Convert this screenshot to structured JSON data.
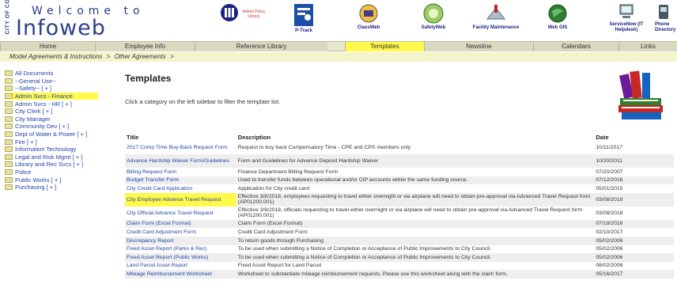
{
  "header": {
    "city_logo": "CITY OF CORONA",
    "welcome": "Welcome to",
    "brand": "Infoweb",
    "apps": [
      {
        "label": "Admin Policy Library",
        "icon": "library-icon"
      },
      {
        "label": "P-Track",
        "icon": "ptrack-icon"
      },
      {
        "label": "ClassWeb",
        "icon": "classweb-icon"
      },
      {
        "label": "SafetyWeb",
        "icon": "safetyweb-icon"
      },
      {
        "label": "Facility Maintenance",
        "icon": "facility-icon"
      },
      {
        "label": "Web GIS",
        "icon": "globe-icon"
      },
      {
        "label": "ServiceNow (IT Helpdesk)",
        "icon": "computer-icon"
      },
      {
        "label": "Phone Directory",
        "icon": "phone-icon"
      }
    ]
  },
  "nav": {
    "tabs": [
      "Home",
      "Employee Info",
      "Reference Library",
      "Templates",
      "Newsline",
      "Calendars",
      "Links"
    ],
    "active": "Templates"
  },
  "breadcrumb": [
    "Model Agreements & Instructions",
    ">",
    "Other Agreements",
    ">"
  ],
  "sidebar": {
    "items": [
      "All Documents",
      "--General Use--",
      "--Safety-- [ + ]",
      "Admin Svcs - Finance",
      "Admin Svcs - HR [ + ]",
      "City Clerk [ + ]",
      "City Manager",
      "Community Dev [ + ]",
      "Dept of Water & Power [ + ]",
      "Fire [ + ]",
      "Information Technology",
      "Legal and Risk Mgmt [ + ]",
      "Library and Rec Svcs [ + ]",
      "Police",
      "Public Works [ + ]",
      "Purchasing [ + ]"
    ],
    "highlighted_index": 3
  },
  "main": {
    "title": "Templates",
    "intro": "Click a category on the left sidebar to filter the template list.",
    "columns": [
      "Title",
      "Description",
      "Date"
    ],
    "rows": [
      {
        "title": "2017 Comp Time Buy-Back Request Form",
        "desc": "Request to buy back Compensatory Time - CPE and CPS members only",
        "date": "10/11/2017"
      },
      {
        "title": "Advance Hardship Waiver Form/Guidelines",
        "desc": "Form and Guidelines for Advance Deposit Hardship Waiver",
        "date": "10/20/2011"
      },
      {
        "title": "Billing Request Form",
        "desc": "Finance Department Billing Request Form",
        "date": "07/20/2007"
      },
      {
        "title": "Budget Transfer Form",
        "desc": "Used to transfer funds between operational and/or CIP accounts within the same funding source.",
        "date": "07/12/2016"
      },
      {
        "title": "City Credit Card Application",
        "desc": "Application for City credit card",
        "date": "05/01/2015"
      },
      {
        "title": "City Employee Advance Travel Request",
        "desc": "Effective 3/8/2018, employees requesting to travel either overnight or via airplane will need to obtain pre-approval via Advanced Travel Request form (AP01200.001)",
        "date": "03/08/2018"
      },
      {
        "title": "City Official Advance Travel Request",
        "desc": "Effective 3/8/2018, officials requesting to travel either overnight or via airplane will need to obtain pre-approval via Advanced Travel Request form (AP01200.001)",
        "date": "03/08/2018"
      },
      {
        "title": "Claim Form (Excel Format)",
        "desc": "Claim Form (Excel Format)",
        "date": "07/19/2016"
      },
      {
        "title": "Credit Card Adjustment Form",
        "desc": "Credit Card Adjustment Form",
        "date": "02/10/2017"
      },
      {
        "title": "Discrepancy Report",
        "desc": "To return goods through Purchasing",
        "date": "05/02/2006"
      },
      {
        "title": "Fixed Asset Report (Parks & Rec)",
        "desc": "To be used when submitting a Notice of Completion or Acceptance of Public Improvements to City Council.",
        "date": "05/02/2006"
      },
      {
        "title": "Fixed Asset Report (Public Works)",
        "desc": "To be used when submitting a Notice of Completion or Acceptance of Public Improvements to City Council.",
        "date": "05/02/2006"
      },
      {
        "title": "Land Parcel Asset Report",
        "desc": "Fixed Asset Report for Land Parcel",
        "date": "08/02/2006"
      },
      {
        "title": "Mileage Reimbursement Worksheet",
        "desc": "Worksheet to substantiate mileage reimbursement requests. Please use this worksheet along with the claim form.",
        "date": "05/16/2017"
      }
    ],
    "highlighted_row": 5
  },
  "colors": {
    "brand_blue": "#2d3f8c",
    "highlight_yellow": "#fff94a",
    "link_blue": "#2244aa"
  }
}
